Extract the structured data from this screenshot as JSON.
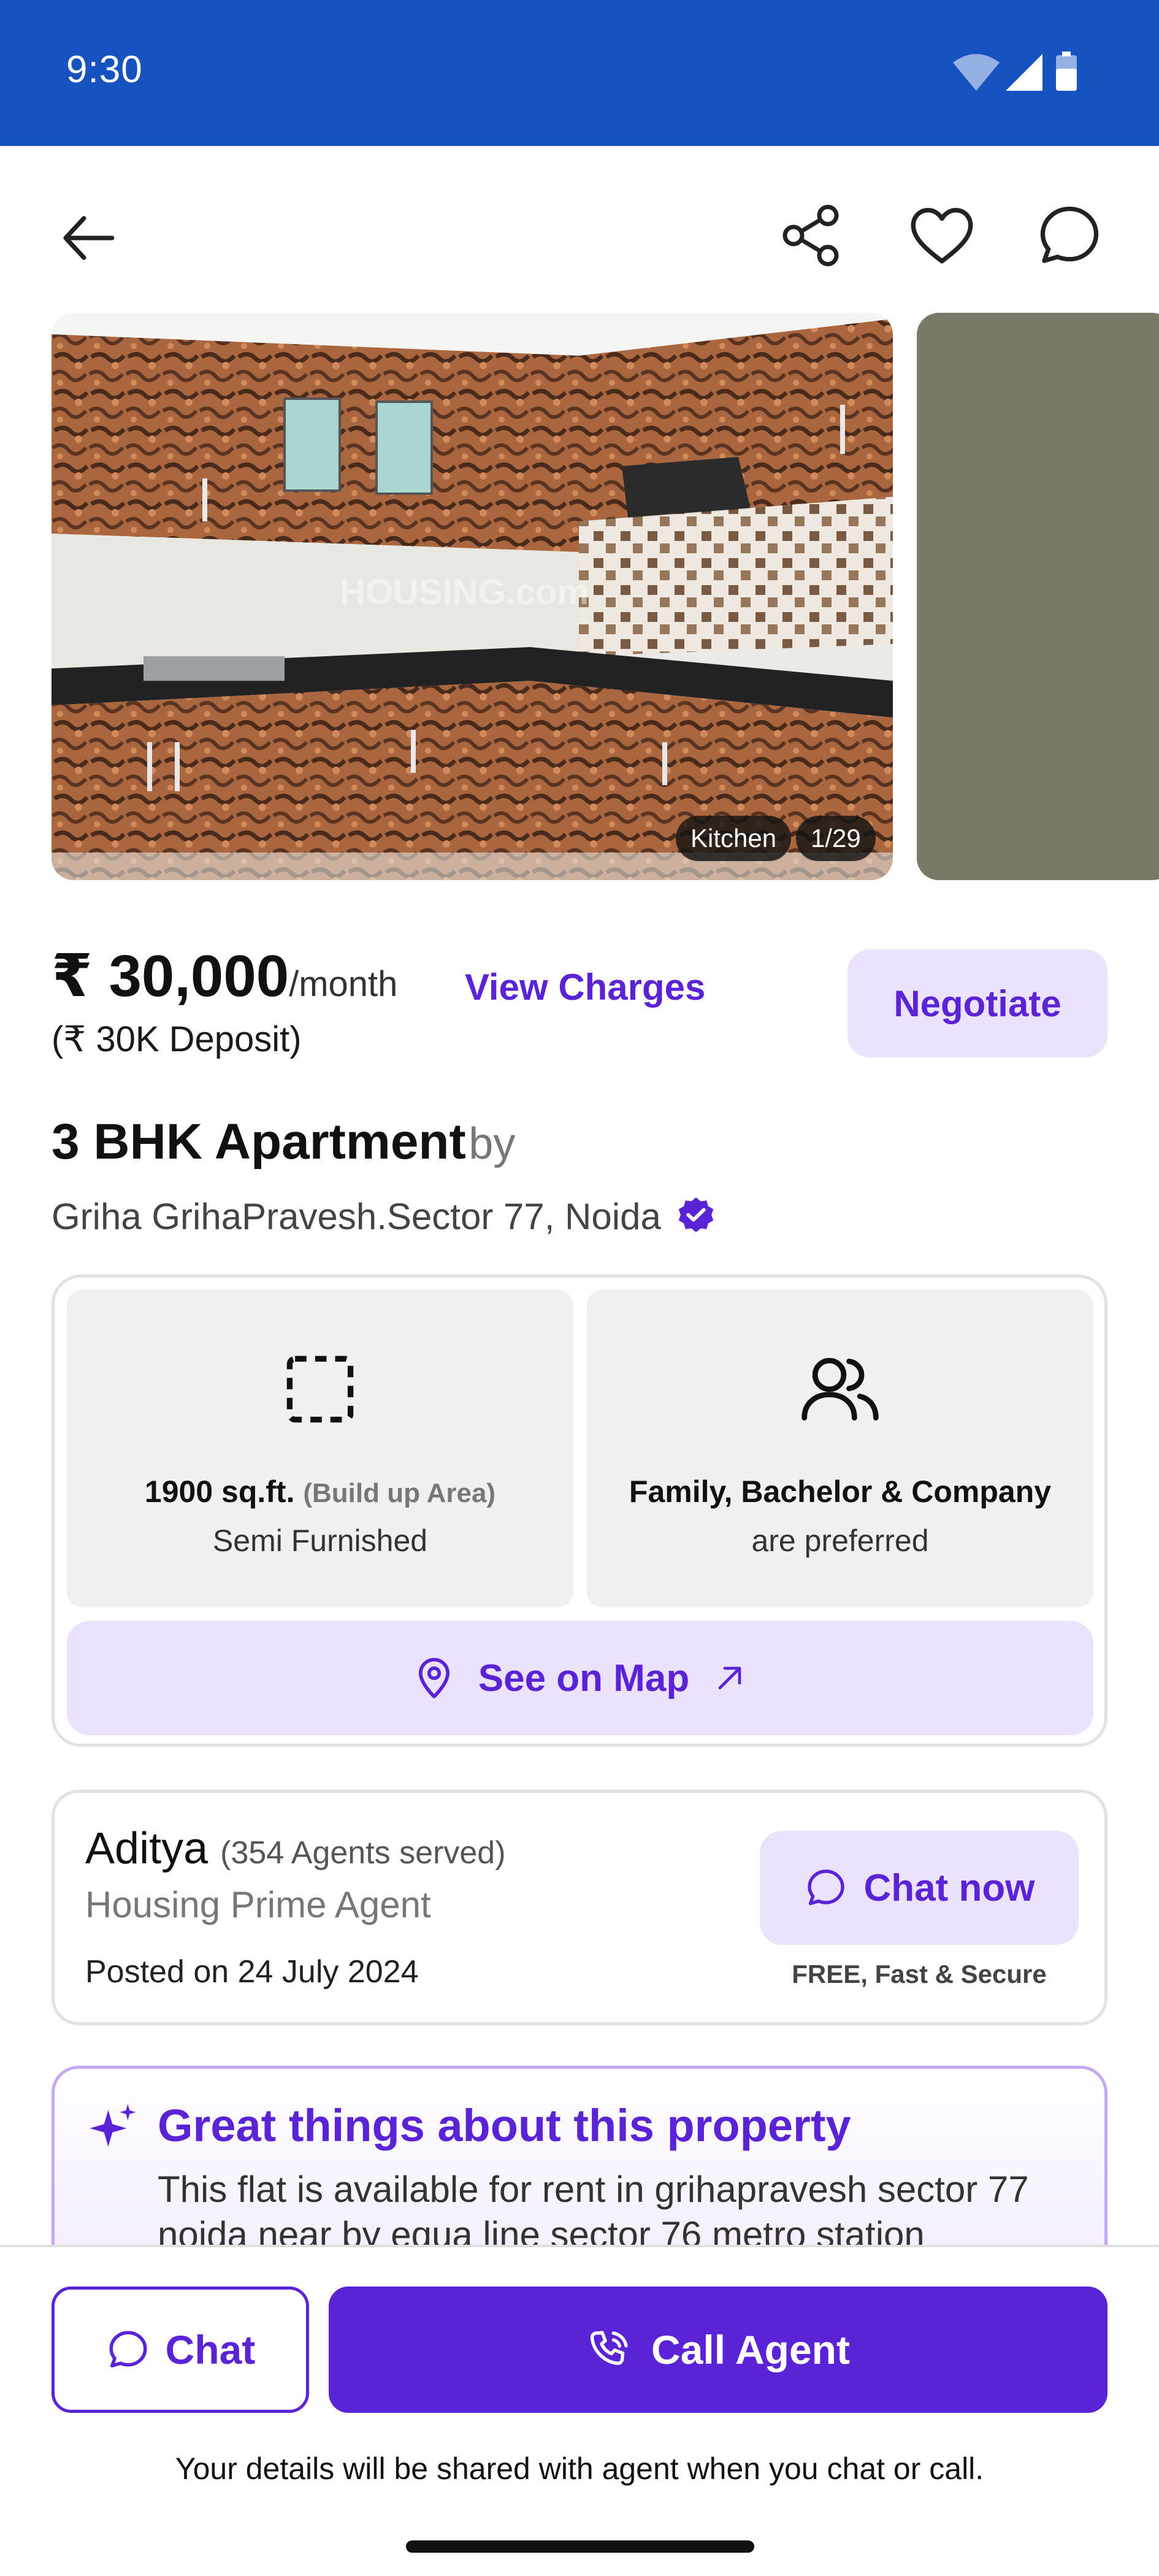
{
  "status_bar": {
    "time": "9:30",
    "icons": [
      "wifi-icon",
      "signal-icon",
      "battery-icon"
    ],
    "background": "#1652c0"
  },
  "top_nav": {
    "icons": [
      "back-arrow-icon",
      "share-icon",
      "heart-icon",
      "chat-bubble-icon"
    ]
  },
  "gallery": {
    "caption": "Kitchen",
    "counter": "1/29",
    "watermark": "HOUSING.com"
  },
  "pricing": {
    "amount": "₹ 30,000",
    "period": "/month",
    "view_charges": "View Charges",
    "deposit": "(₹ 30K Deposit)",
    "negotiate": "Negotiate"
  },
  "property": {
    "title": "3 BHK Apartment",
    "by": "by",
    "builder": "Griha GrihaPravesh.Sector 77, Noida"
  },
  "features": {
    "area_value": "1900 sq.ft.",
    "area_label": "(Build up Area)",
    "furnishing": "Semi Furnished",
    "tenants": "Family, Bachelor & Company",
    "tenants_sub": "are preferred",
    "see_on_map": "See on Map"
  },
  "agent": {
    "name": "Aditya",
    "served": "(354 Agents served)",
    "type": "Housing Prime Agent",
    "posted": "Posted on 24 July 2024",
    "chat_now": "Chat now",
    "free_note": "FREE, Fast & Secure"
  },
  "highlights": {
    "title": "Great things about this property",
    "text": "This flat is available for rent in grihapravesh sector 77 noida near by equa line sector 76 metro station"
  },
  "bottom_bar": {
    "chat": "Chat",
    "call": "Call Agent",
    "disclaimer": "Your details will be shared with agent when you chat or call."
  },
  "colors": {
    "accent": "#5a23d6",
    "accent_light": "#ebe2fd",
    "verified": "#5a23d6"
  }
}
